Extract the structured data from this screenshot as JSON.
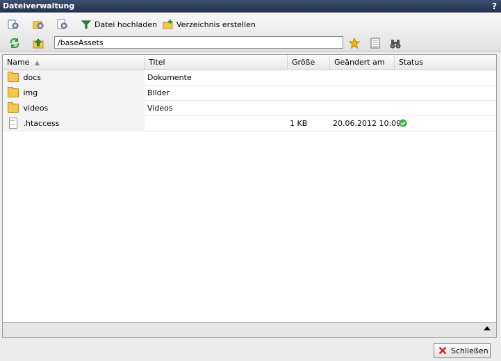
{
  "window": {
    "title": "Dateiverwaltung",
    "help_label": "?"
  },
  "toolbar": {
    "upload_label": "Datei hochladen",
    "mkdir_label": "Verzeichnis erstellen",
    "path_value": "/baseAssets"
  },
  "table": {
    "columns": [
      "Name",
      "Titel",
      "Größe",
      "Geändert am",
      "Status"
    ],
    "rows": [
      {
        "name": "docs",
        "title": "Dokumente",
        "size": "",
        "modified": "",
        "type": "folder"
      },
      {
        "name": "img",
        "title": "Bilder",
        "size": "",
        "modified": "",
        "type": "folder"
      },
      {
        "name": "videos",
        "title": "Videos",
        "size": "",
        "modified": "",
        "type": "folder"
      },
      {
        "name": ".htaccess",
        "title": "",
        "size": "1 KB",
        "modified": "20.06.2012 10:09",
        "type": "file",
        "status": "ok"
      }
    ]
  },
  "footer": {
    "close_label": "Schließen"
  },
  "colors": {
    "accent": "#22314e",
    "star": "#f5b301",
    "status_ok": "#3cb043",
    "close_x": "#d62020",
    "refresh": "#2e9b2e"
  },
  "icons": [
    "settings-icon",
    "settings-icon",
    "settings-icon",
    "upload-icon",
    "new-folder-icon",
    "refresh-icon",
    "folder-up-icon",
    "star-icon",
    "details-view-icon",
    "binoculars-icon",
    "folder-icon",
    "file-icon",
    "checkmark-icon",
    "close-icon"
  ]
}
